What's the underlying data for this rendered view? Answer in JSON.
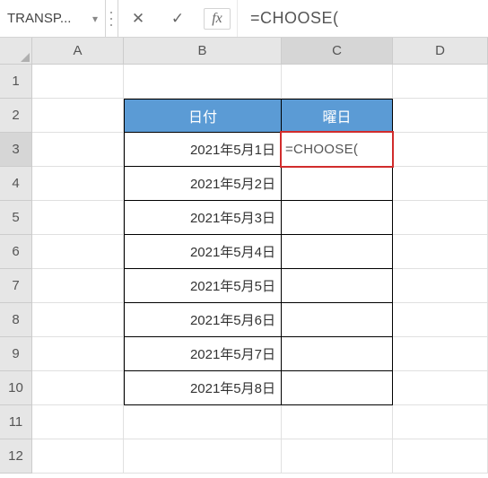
{
  "name_box": "TRANSP...",
  "formula_bar": {
    "cancel_glyph": "✕",
    "enter_glyph": "✓",
    "fx_label": "fx",
    "value": "=CHOOSE("
  },
  "columns": {
    "A": "A",
    "B": "B",
    "C": "C",
    "D": "D"
  },
  "rows": [
    "1",
    "2",
    "3",
    "4",
    "5",
    "6",
    "7",
    "8",
    "9",
    "10",
    "11",
    "12"
  ],
  "headers": {
    "date": "日付",
    "weekday": "曜日"
  },
  "dates": [
    "2021年5月1日",
    "2021年5月2日",
    "2021年5月3日",
    "2021年5月4日",
    "2021年5月5日",
    "2021年5月6日",
    "2021年5月7日",
    "2021年5月8日"
  ],
  "editing_cell": {
    "ref": "C3",
    "display": "=CHOOSE("
  }
}
